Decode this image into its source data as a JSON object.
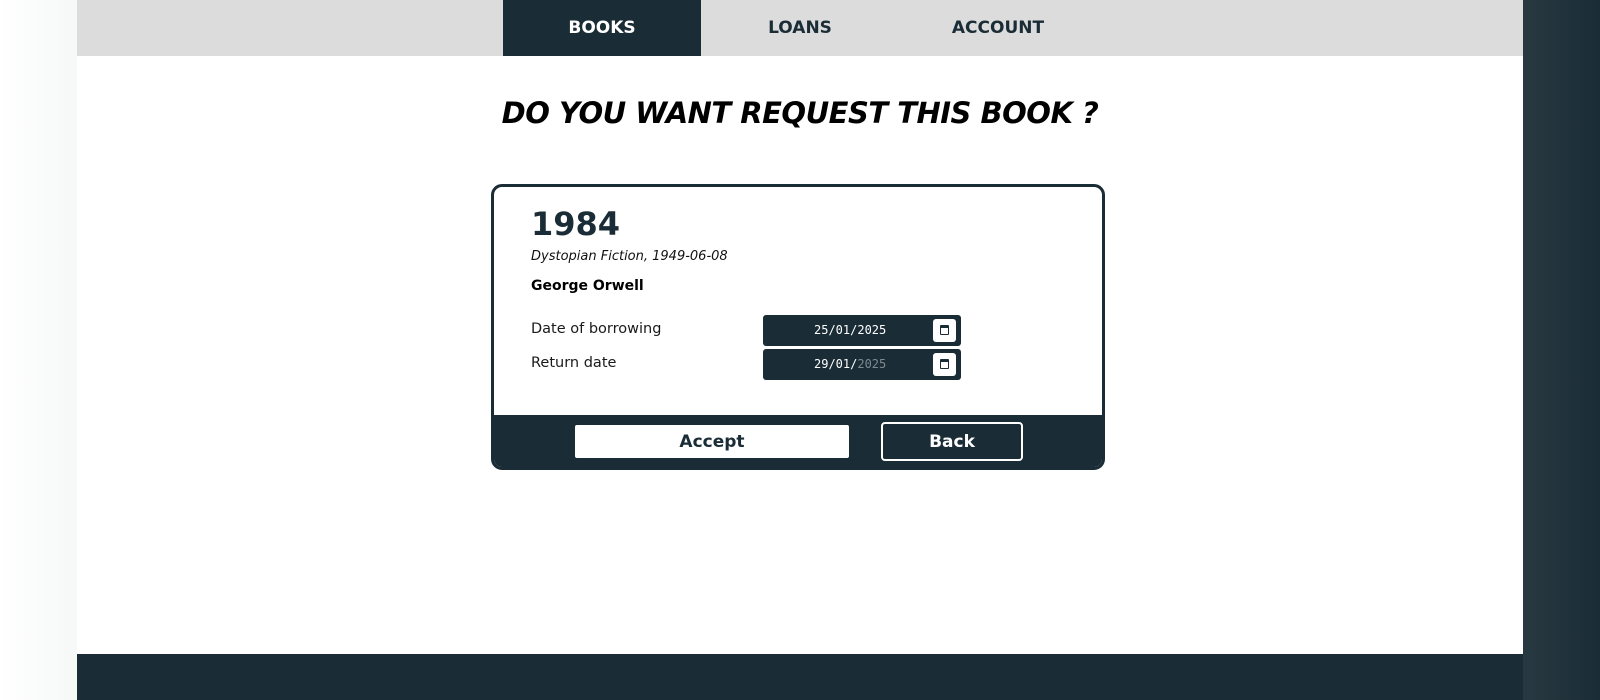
{
  "nav": {
    "tabs": [
      {
        "label": "BOOKS",
        "active": true
      },
      {
        "label": "LOANS",
        "active": false
      },
      {
        "label": "ACCOUNT",
        "active": false
      }
    ]
  },
  "main": {
    "heading": "DO YOU WANT REQUEST THIS BOOK ?"
  },
  "book": {
    "title": "1984",
    "meta": "Dystopian Fiction, 1949-06-08",
    "author": "George Orwell"
  },
  "form": {
    "borrow_label": "Date of borrowing",
    "borrow_value": "25/01/2025",
    "return_label": "Return date",
    "return_value_set": "29/01/",
    "return_value_placeholder": "2025"
  },
  "actions": {
    "accept_label": "Accept",
    "back_label": "Back"
  },
  "colors": {
    "primary": "#1a2c35",
    "nav_bg": "#dcdcdc",
    "page_bg": "#ffffff"
  },
  "icons": {
    "calendar": "calendar-icon"
  }
}
